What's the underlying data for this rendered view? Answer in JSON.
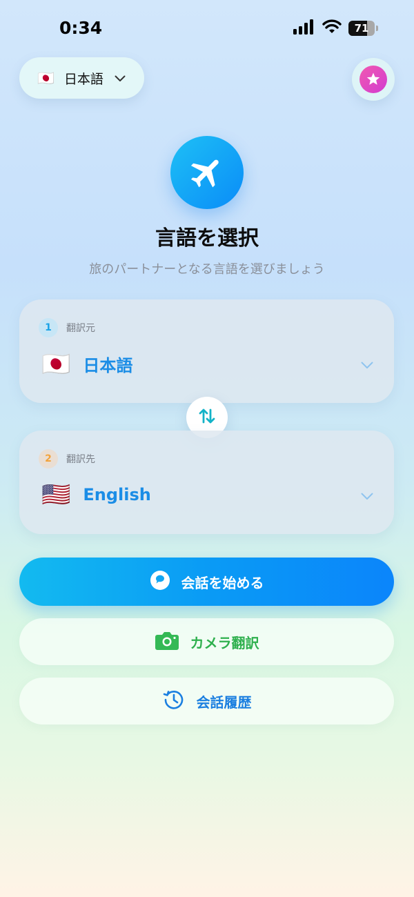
{
  "status_bar": {
    "time": "0:34",
    "battery_level": "71",
    "battery_fraction": 0.71
  },
  "header": {
    "ui_language": {
      "flag": "🇯🇵",
      "label": "日本語"
    }
  },
  "hero": {
    "icon": "airplane-icon",
    "title": "言語を選択",
    "subtitle": "旅のパートナーとなる言語を選びましょう"
  },
  "source": {
    "step": "1",
    "label": "翻訳元",
    "flag": "🇯🇵",
    "language": "日本語"
  },
  "target": {
    "step": "2",
    "label": "翻訳先",
    "flag": "🇺🇸",
    "language": "English"
  },
  "actions": {
    "start_conversation": "会話を始める",
    "camera_translate": "カメラ翻訳",
    "conversation_history": "会話履歴"
  },
  "colors": {
    "accent_blue": "#0a8cf8",
    "camera_green": "#2fb04e",
    "history_blue": "#1b7fe0",
    "premium_pink": "#e84bb8"
  }
}
